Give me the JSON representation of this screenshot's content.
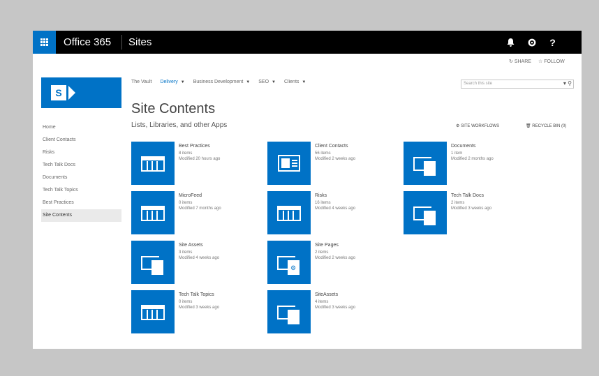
{
  "suite_bar": {
    "brand": "Office 365",
    "section": "Sites",
    "bell_glyph": "♪",
    "gear_glyph": "⚙",
    "help_glyph": "?"
  },
  "ribbon": {
    "share_label": "SHARE",
    "follow_label": "FOLLOW"
  },
  "site_logo": {
    "letter": "S"
  },
  "top_nav": [
    {
      "label": "The Vault"
    },
    {
      "label": "Delivery",
      "selected": true
    },
    {
      "label": "Business Development"
    },
    {
      "label": "SEO"
    },
    {
      "label": "Clients"
    }
  ],
  "search": {
    "placeholder": "Search this site"
  },
  "page": {
    "title": "Site Contents"
  },
  "quick_launch": [
    {
      "label": "Home"
    },
    {
      "label": "Client Contacts"
    },
    {
      "label": "Risks"
    },
    {
      "label": "Tech Talk Docs"
    },
    {
      "label": "Documents"
    },
    {
      "label": "Tech Talk Topics"
    },
    {
      "label": "Best Practices"
    },
    {
      "label": "Site Contents",
      "active": true
    }
  ],
  "content_header": {
    "title": "Lists, Libraries, and other Apps",
    "workflows_label": "SITE WORKFLOWS",
    "recycle_label": "RECYCLE BIN (0)"
  },
  "apps": [
    {
      "name": "Best Practices",
      "count": "8 items",
      "modified": "Modified 20 hours ago",
      "icon": "list-icon"
    },
    {
      "name": "Client Contacts",
      "count": "56 items",
      "modified": "Modified 2 weeks ago",
      "icon": "contacts-icon"
    },
    {
      "name": "Documents",
      "count": "1 item",
      "modified": "Modified 2 months ago",
      "icon": "document-library-icon"
    },
    {
      "name": "MicroFeed",
      "count": "0 items",
      "modified": "Modified 7 months ago",
      "icon": "list-icon"
    },
    {
      "name": "Risks",
      "count": "16 items",
      "modified": "Modified 4 weeks ago",
      "icon": "list-icon"
    },
    {
      "name": "Tech Talk Docs",
      "count": "2 items",
      "modified": "Modified 3 weeks ago",
      "icon": "document-library-icon"
    },
    {
      "name": "Site Assets",
      "count": "3 items",
      "modified": "Modified 4 weeks ago",
      "icon": "document-library-icon"
    },
    {
      "name": "Site Pages",
      "count": "2 items",
      "modified": "Modified 2 weeks ago",
      "icon": "site-pages-icon"
    },
    {
      "name": "Tech Talk Topics",
      "count": "0 items",
      "modified": "Modified 3 weeks ago",
      "icon": "list-icon"
    },
    {
      "name": "SiteAssets",
      "count": "4 items",
      "modified": "Modified 3 weeks ago",
      "icon": "document-library-icon"
    }
  ],
  "colors": {
    "accent": "#0072c6",
    "suite_bar": "#000000",
    "backdrop": "#c6c6c6"
  }
}
